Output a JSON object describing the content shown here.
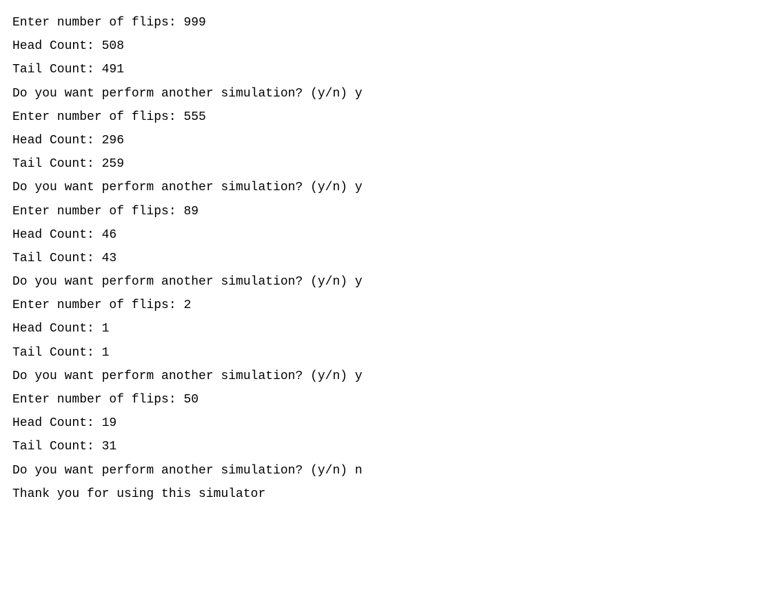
{
  "terminal": {
    "lines": [
      "Enter number of flips: 999",
      "Head Count: 508",
      "Tail Count: 491",
      "Do you want perform another simulation? (y/n) y",
      "Enter number of flips: 555",
      "Head Count: 296",
      "Tail Count: 259",
      "Do you want perform another simulation? (y/n) y",
      "Enter number of flips: 89",
      "Head Count: 46",
      "Tail Count: 43",
      "Do you want perform another simulation? (y/n) y",
      "Enter number of flips: 2",
      "Head Count: 1",
      "Tail Count: 1",
      "Do you want perform another simulation? (y/n) y",
      "Enter number of flips: 50",
      "Head Count: 19",
      "Tail Count: 31",
      "Do you want perform another simulation? (y/n) n",
      "Thank you for using this simulator"
    ]
  }
}
